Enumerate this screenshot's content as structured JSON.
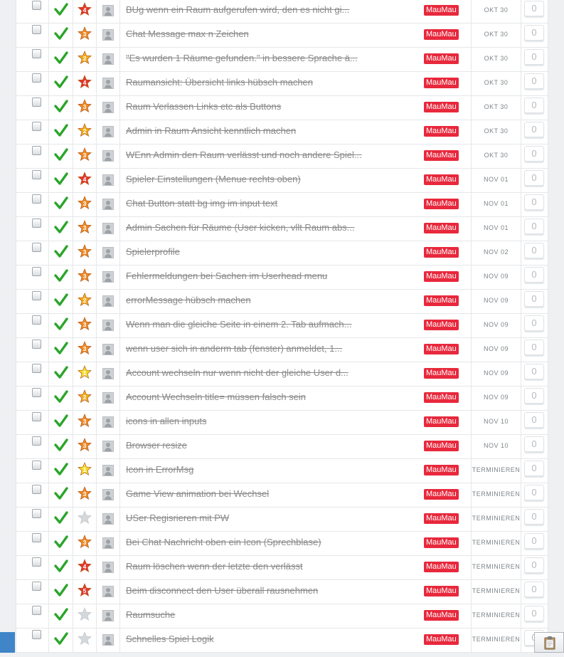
{
  "colors": {
    "tag_bg": "#e8283c",
    "check_green": "#2aa52a",
    "star_red": "#e2372c",
    "star_orange": "#f08a24",
    "star_gold": "#f3ad1c",
    "star_yellow": "#f6dd2a",
    "star_empty": "#d5d8db"
  },
  "icons": {
    "done": "check-icon",
    "priority": "star-icon",
    "assignee": "avatar-icon",
    "clipboard": "clipboard-icon"
  },
  "tasks": [
    {
      "title": "BUg wenn ein Raum aufgerufen wird, den es nicht gi...",
      "tag": "MauMau",
      "date": "OKT 30",
      "count": "0",
      "prio": "4"
    },
    {
      "title": "Chat Message max n Zeichen",
      "tag": "MauMau",
      "date": "OKT 30",
      "count": "0",
      "prio": "3"
    },
    {
      "title": "\"Es wurden 1 Räume gefunden.\" in bessere Sprache ä...",
      "tag": "MauMau",
      "date": "OKT 30",
      "count": "0",
      "prio": "2"
    },
    {
      "title": "Raumansicht: Übersicht links hübsch machen",
      "tag": "MauMau",
      "date": "OKT 30",
      "count": "0",
      "prio": "4"
    },
    {
      "title": "Raum Verlassen Links etc als Buttons",
      "tag": "MauMau",
      "date": "OKT 30",
      "count": "0",
      "prio": "3"
    },
    {
      "title": "Admin in Raum Ansicht kenntlich machen",
      "tag": "MauMau",
      "date": "OKT 30",
      "count": "0",
      "prio": "2"
    },
    {
      "title": "WEnn Admin den Raum verlässt und noch andere Spiel...",
      "tag": "MauMau",
      "date": "OKT 30",
      "count": "0",
      "prio": "3"
    },
    {
      "title": "Spieler Einstellungen (Menue rechts oben)",
      "tag": "MauMau",
      "date": "NOV 01",
      "count": "0",
      "prio": "4"
    },
    {
      "title": "Chat Button statt bg img im input text",
      "tag": "MauMau",
      "date": "NOV 01",
      "count": "0",
      "prio": "3"
    },
    {
      "title": "Admin Sachen für Räume (User kicken, vllt Raum abs...",
      "tag": "MauMau",
      "date": "NOV 01",
      "count": "0",
      "prio": "3"
    },
    {
      "title": "Spielerprofile",
      "tag": "MauMau",
      "date": "NOV 02",
      "count": "0",
      "prio": "3"
    },
    {
      "title": "Fehlermeldungen bei Sachen im Userhead menu",
      "tag": "MauMau",
      "date": "NOV 09",
      "count": "0",
      "prio": "3"
    },
    {
      "title": "errorMessage hübsch machen",
      "tag": "MauMau",
      "date": "NOV 09",
      "count": "0",
      "prio": "2"
    },
    {
      "title": "Wenn man die gleiche Seite in einem 2. Tab aufmach...",
      "tag": "MauMau",
      "date": "NOV 09",
      "count": "0",
      "prio": "3"
    },
    {
      "title": "wenn user sich in anderm tab (fenster) anmeldet, 1...",
      "tag": "MauMau",
      "date": "NOV 09",
      "count": "0",
      "prio": "3"
    },
    {
      "title": "Account wechseln nur wenn nicht der gleiche User d...",
      "tag": "MauMau",
      "date": "NOV 09",
      "count": "0",
      "prio": "1"
    },
    {
      "title": "Account Wechseln title= müssen falsch sein",
      "tag": "MauMau",
      "date": "NOV 09",
      "count": "0",
      "prio": "2"
    },
    {
      "title": "icons in allen inputs",
      "tag": "MauMau",
      "date": "NOV 10",
      "count": "0",
      "prio": "3"
    },
    {
      "title": "Browser resize",
      "tag": "MauMau",
      "date": "NOV 10",
      "count": "0",
      "prio": "3"
    },
    {
      "title": "Icon in ErrorMsg",
      "tag": "MauMau",
      "date": "TERMINIEREN",
      "count": "0",
      "prio": "1"
    },
    {
      "title": "Game View animation bei Wechsel",
      "tag": "MauMau",
      "date": "TERMINIEREN",
      "count": "0",
      "prio": "3"
    },
    {
      "title": "USer Regisrieren mit PW",
      "tag": "MauMau",
      "date": "TERMINIEREN",
      "count": "0",
      "prio": ""
    },
    {
      "title": "Bei Chat Nachricht oben ein Icon (Sprechblase)",
      "tag": "MauMau",
      "date": "TERMINIEREN",
      "count": "0",
      "prio": "3"
    },
    {
      "title": "Raum löschen wenn der letzte den verlässt",
      "tag": "MauMau",
      "date": "TERMINIEREN",
      "count": "0",
      "prio": "4"
    },
    {
      "title": "Beim disconnect den User überall rausnehmen",
      "tag": "MauMau",
      "date": "TERMINIEREN",
      "count": "0",
      "prio": "5"
    },
    {
      "title": "Raumsuche",
      "tag": "MauMau",
      "date": "TERMINIEREN",
      "count": "0",
      "prio": ""
    },
    {
      "title": "Schnelles Spiel Logik",
      "tag": "MauMau",
      "date": "TERMINIEREN",
      "count": "0",
      "prio": ""
    }
  ]
}
